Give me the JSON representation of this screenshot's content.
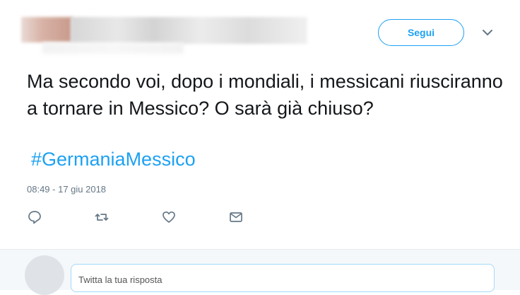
{
  "tweet": {
    "follow_label": "Segui",
    "more_icon": "chevron-down-icon",
    "text": "Ma secondo voi, dopo i mondiali, i messicani riusciranno a tornare in Messico? O sarà già chiuso?",
    "hashtag": "#GermaniaMessico",
    "timestamp": "08:49 - 17 giu 2018",
    "actions": [
      "reply-icon",
      "retweet-icon",
      "like-icon",
      "direct-message-icon"
    ]
  },
  "reply": {
    "placeholder": "Twitta la tua risposta"
  },
  "colors": {
    "accent": "#1da1f2",
    "text": "#14171a",
    "muted": "#657786",
    "reply_bg": "#f5f8fa"
  }
}
